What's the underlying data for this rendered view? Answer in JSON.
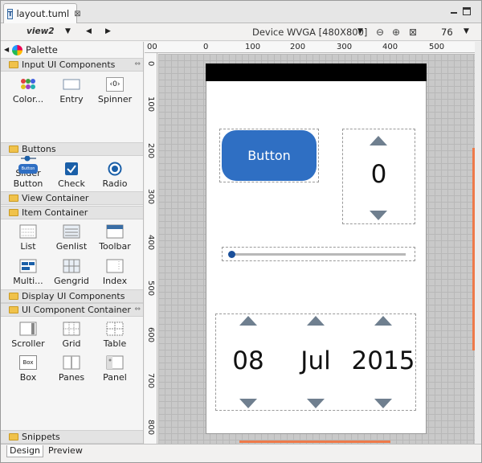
{
  "editor_tab": {
    "file_icon_letter": "T",
    "label": "layout.tuml",
    "close_glyph": "⊠"
  },
  "toolbar": {
    "view_name": "view2",
    "device": "Device WVGA [480X800]",
    "zoom": "76",
    "icons": [
      "dropdown-arrow",
      "back-arrow",
      "forward-arrow",
      "zoom-out",
      "zoom-in",
      "fit-screen",
      "zoom-dropdown"
    ]
  },
  "palette": {
    "title": "Palette",
    "categories": {
      "input": "Input UI Components",
      "buttons": "Buttons",
      "view_container": "View Container",
      "item_container": "Item Container",
      "display": "Display UI Components",
      "component_container": "UI Component Container",
      "snippets": "Snippets"
    },
    "input_items": [
      "Color...",
      "Entry",
      "Spinner",
      "Slider"
    ],
    "button_items": [
      "Button",
      "Check",
      "Radio"
    ],
    "button_icon_text": "Button",
    "spinner_icon_text": "‹0›",
    "item_items": [
      "List",
      "Genlist",
      "Toolbar",
      "Multi...",
      "Gengrid",
      "Index"
    ],
    "container_items": [
      "Scroller",
      "Grid",
      "Table",
      "Box",
      "Panes",
      "Panel"
    ],
    "box_icon_text": "Box"
  },
  "rulers": {
    "top": [
      "00",
      "0",
      "100",
      "200",
      "300",
      "400",
      "500"
    ],
    "left": [
      "0",
      "100",
      "200",
      "300",
      "400",
      "500",
      "600",
      "700",
      "800"
    ]
  },
  "device_preview": {
    "button_label": "Button",
    "spinner_value": "0",
    "date": {
      "day": "08",
      "month": "Jul",
      "year": "2015"
    }
  },
  "bottom_tabs": [
    "Design",
    "Preview"
  ],
  "colors": {
    "accent_orange": "#ee7a4a",
    "button_blue": "#2f6fc3",
    "slider_knob": "#1a4f9a"
  }
}
